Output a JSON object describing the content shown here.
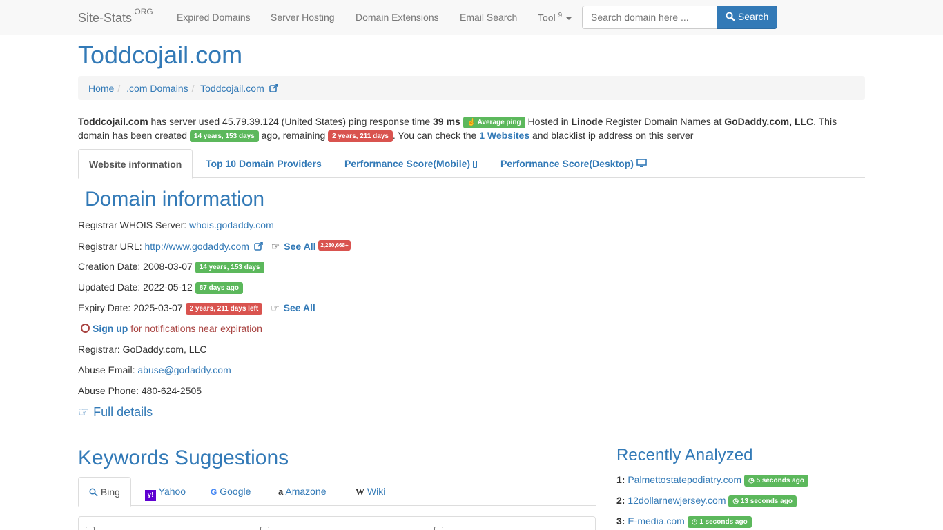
{
  "nav": {
    "brand": "Site-Stats",
    "brand_sup": ".ORG",
    "links": [
      "Expired Domains",
      "Server Hosting",
      "Domain Extensions",
      "Email Search"
    ],
    "tool_label": "Tool",
    "tool_count": "9",
    "search_placeholder": "Search domain here ...",
    "search_button": "Search"
  },
  "page_title": "Toddcojail.com",
  "breadcrumb": [
    "Home",
    ".com Domains",
    "Toddcojail.com"
  ],
  "intro": {
    "domain": "Toddcojail.com",
    "t1": " has server used 45.79.39.124 (United States) ping response time ",
    "ping": "39 ms",
    "ping_badge": "Average ping",
    "t2": " Hosted in ",
    "host": "Linode",
    "t3": " Register Domain Names at ",
    "registrar": "GoDaddy.com, LLC",
    "t4": ". This domain has been created ",
    "age_badge": "14 years, 153 days",
    "t5": " ago, remaining ",
    "remain_badge": "2 years, 211 days",
    "t6": ". You can check the ",
    "websites_link": "1 Websites",
    "t7": " and blacklist ip address on this server"
  },
  "tabs": [
    "Website information",
    "Top 10 Domain Providers",
    "Performance Score(Mobile)",
    "Performance Score(Desktop)"
  ],
  "domain_info": {
    "title": "Domain information",
    "whois_label": "Registrar WHOIS Server: ",
    "whois_value": "whois.godaddy.com",
    "url_label": "Registrar URL: ",
    "url_value": "http://www.godaddy.com",
    "see_all": "See All",
    "see_all_count": "2,280,668+",
    "creation_label": "Creation Date: ",
    "creation_value": "2008-03-07",
    "creation_badge": "14 years, 153 days",
    "updated_label": "Updated Date: ",
    "updated_value": "2022-05-12",
    "updated_badge": "87 days ago",
    "expiry_label": "Expiry Date: ",
    "expiry_value": "2025-03-07",
    "expiry_badge": "2 years, 211 days left",
    "signup_link": "Sign up",
    "signup_text": " for notifications near expiration",
    "registrar_label": "Registrar: ",
    "registrar_value": "GoDaddy.com, LLC",
    "abuse_email_label": "Abuse Email: ",
    "abuse_email_value": "abuse@godaddy.com",
    "abuse_phone_label": "Abuse Phone: ",
    "abuse_phone_value": "480-624-2505",
    "full_details": "Full details"
  },
  "keywords": {
    "title": "Keywords Suggestions",
    "tabs": [
      "Bing",
      "Yahoo",
      "Google",
      "Amazone",
      "Wiki"
    ]
  },
  "recent": {
    "title": "Recently Analyzed",
    "items": [
      {
        "num": "1:",
        "domain": "Palmettostatepodiatry.com",
        "time": "5 seconds ago"
      },
      {
        "num": "2:",
        "domain": "12dollarnewjersey.com",
        "time": "13 seconds ago"
      },
      {
        "num": "3:",
        "domain": "E-media.com",
        "time": "1 seconds ago"
      }
    ]
  },
  "colors": {
    "link": "#337ab7",
    "success": "#5cb85c",
    "danger": "#d9534f"
  }
}
